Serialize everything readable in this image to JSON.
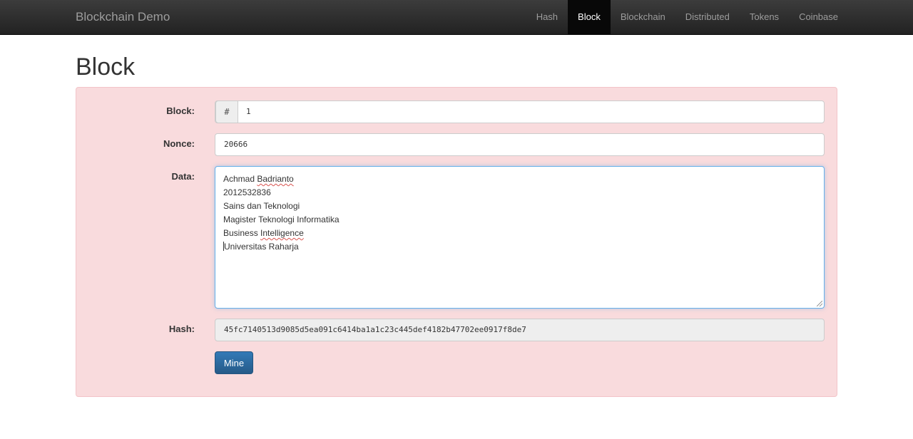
{
  "navbar": {
    "brand": "Blockchain Demo",
    "items": [
      {
        "label": "Hash",
        "active": false
      },
      {
        "label": "Block",
        "active": true
      },
      {
        "label": "Blockchain",
        "active": false
      },
      {
        "label": "Distributed",
        "active": false
      },
      {
        "label": "Tokens",
        "active": false
      },
      {
        "label": "Coinbase",
        "active": false
      }
    ]
  },
  "page": {
    "title": "Block"
  },
  "form": {
    "block": {
      "label": "Block:",
      "addon": "#",
      "value": "1"
    },
    "nonce": {
      "label": "Nonce:",
      "value": "20666"
    },
    "data": {
      "label": "Data:",
      "lines": [
        "Achmad Badrianto",
        "2012532836",
        "Sains dan Teknologi",
        "Magister Teknologi Informatika",
        "Business Intelligence",
        "Universitas Raharja"
      ],
      "line_parts": [
        [
          "Achmad ",
          "Badrianto"
        ],
        [
          "2012532836",
          ""
        ],
        [
          "Sains dan Teknologi",
          ""
        ],
        [
          "Magister Teknologi Informatika",
          ""
        ],
        [
          "Business ",
          "Intelligence"
        ],
        [
          "Universitas Raharja",
          ""
        ]
      ]
    },
    "hash": {
      "label": "Hash:",
      "value": "45fc7140513d9085d5ea091c6414ba1a1c23c445def4182b47702ee0917f8de7"
    },
    "mine_label": "Mine"
  },
  "colors": {
    "panel_bg": "#f9dbdd",
    "navbar_bg": "#222222",
    "button_bg": "#337ab7"
  }
}
